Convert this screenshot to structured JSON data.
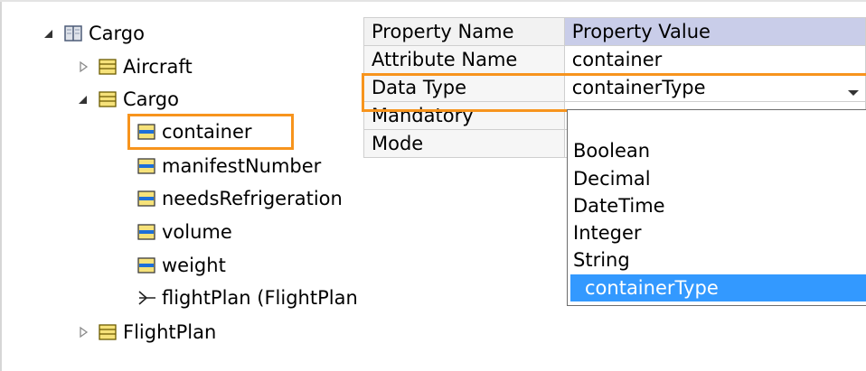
{
  "tree": {
    "root": "Cargo",
    "aircraft": "Aircraft",
    "cargo_class": "Cargo",
    "attributes": [
      "container",
      "manifestNumber",
      "needsRefrigeration",
      "volume",
      "weight"
    ],
    "association": "flightPlan (FlightPlan",
    "flightplan": "FlightPlan"
  },
  "grid": {
    "header_name": "Property Name",
    "header_value": "Property Value",
    "rows": [
      {
        "name": "Attribute Name",
        "value": "container"
      },
      {
        "name": "Data Type",
        "value": "containerType"
      },
      {
        "name": "Mandatory",
        "value": ""
      },
      {
        "name": "Mode",
        "value": ""
      }
    ]
  },
  "dropdown": {
    "options": [
      "Boolean",
      "Decimal",
      "DateTime",
      "Integer",
      "String"
    ],
    "selected": "containerType"
  },
  "colors": {
    "highlight": "#f7941d",
    "selection": "#3399ff",
    "header_value_bg": "#c9cde9"
  },
  "icons": {
    "root": "book-icon",
    "class": "class-icon",
    "attribute": "attribute-icon",
    "association": "association-arrow-icon",
    "dropdown": "chevron-down-icon"
  }
}
